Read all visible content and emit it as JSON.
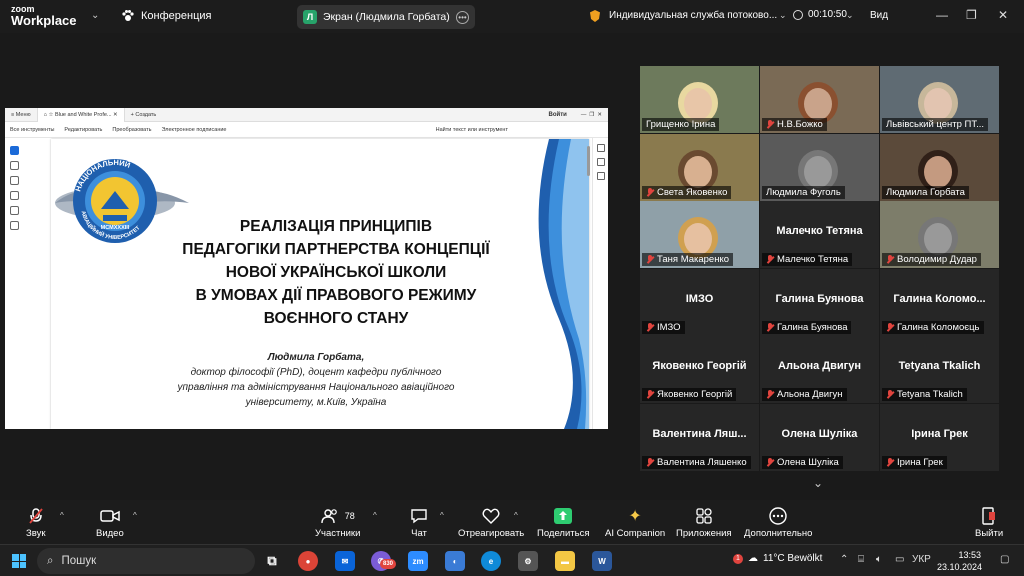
{
  "app": {
    "logo_top": "zoom",
    "logo_bottom": "Workplace",
    "meeting_label": "Конференция"
  },
  "screen_share": {
    "badge": "Л",
    "label": "Экран (Людмила Горбата)"
  },
  "service": {
    "label": "Индивидуальная служба потоково..."
  },
  "timer": {
    "value": "00:10:50"
  },
  "view": {
    "label": "Вид"
  },
  "acrobat": {
    "menu": "Меню",
    "tab_label": "Blue and White Profe...",
    "new_tab": "Создать",
    "signin": "Войти",
    "tools": [
      "Все инструменты",
      "Редактировать",
      "Преобразовать",
      "Электронное подписание"
    ],
    "find_placeholder": "Найти текст или инструмент"
  },
  "slide": {
    "emblem": {
      "top_text": "НАЦІОНАЛЬНИЙ",
      "bottom_text": "АВІАЦІЙНИЙ УНІВЕРСИТЕТ",
      "year": "MCMXXXIII"
    },
    "title_lines": [
      "РЕАЛІЗАЦІЯ ПРИНЦИПІВ",
      "ПЕДАГОГІКИ ПАРТНЕРСТВА КОНЦЕПЦІЇ",
      "НОВОЇ УКРАЇНСЬКОЇ ШКОЛИ",
      "В УМОВАХ ДІЇ ПРАВОВОГО РЕЖИМУ",
      "ВОЄННОГО СТАНУ"
    ],
    "author_name": "Людмила Горбата,",
    "author_lines": [
      "доктор філософії (PhD), доцент кафедри публічного",
      "управління та адміністрування Національного авіаційного",
      "університету, м.Київ, Україна"
    ]
  },
  "participants_grid": [
    {
      "name": "Грищенко Ірина",
      "video": true,
      "muted": false
    },
    {
      "name": "Н.В.Божко",
      "video": true,
      "muted": true
    },
    {
      "name": "Львівський центр ПТ...",
      "video": true,
      "muted": false
    },
    {
      "name": "Света Яковенко",
      "video": true,
      "muted": true
    },
    {
      "name": "Людмила Фуголь",
      "video": true,
      "muted": false
    },
    {
      "name": "Людмила Горбата",
      "video": true,
      "muted": false,
      "active": true
    },
    {
      "name": "Таня Макаренко",
      "video": true,
      "muted": true
    },
    {
      "name": "Малечко Тетяна",
      "display": "Малечко Тетяна",
      "video": false,
      "muted": true
    },
    {
      "name": "Володимир Дудар",
      "video": true,
      "muted": true
    },
    {
      "name": "ІМЗО",
      "display": "ІМЗО",
      "video": false,
      "muted": true
    },
    {
      "name": "Галина Буянова",
      "display": "Галина Буянова",
      "video": false,
      "muted": true
    },
    {
      "name": "Галина Коломоєць",
      "display": "Галина  Коломо...",
      "video": false,
      "muted": true
    },
    {
      "name": "Яковенко Георгій",
      "display": "Яковенко Георгій",
      "video": false,
      "muted": true
    },
    {
      "name": "Альона Двигун",
      "display": "Альона Двигун",
      "video": false,
      "muted": true
    },
    {
      "name": "Tetyana Tkalich",
      "display": "Tetyana Tkalich",
      "video": false,
      "muted": true
    },
    {
      "name": "Валентина Ляшенко",
      "display": "Валентина  Ляш...",
      "video": false,
      "muted": true
    },
    {
      "name": "Олена Шуліка",
      "display": "Олена Шуліка",
      "video": false,
      "muted": true
    },
    {
      "name": "Ірина Грек",
      "display": "Ірина Грек",
      "video": false,
      "muted": true
    }
  ],
  "toolbar": {
    "audio": "Звук",
    "video": "Видео",
    "participants": "Участники",
    "participants_count": "78",
    "chat": "Чат",
    "react": "Отреагировать",
    "share": "Поделиться",
    "ai": "AI Companion",
    "apps": "Приложения",
    "more": "Дополнительно",
    "leave": "Выйти"
  },
  "taskbar": {
    "search": "Пошук",
    "badge_count": "830",
    "weather_badge": "1",
    "weather": "11°C  Bewölkt",
    "lang": "УКР",
    "time": "13:53",
    "date": "23.10.2024"
  },
  "colors": {
    "accent_green": "#2ecc71",
    "muted_red": "#e0443e",
    "slide_blue": "#1f5fae"
  }
}
